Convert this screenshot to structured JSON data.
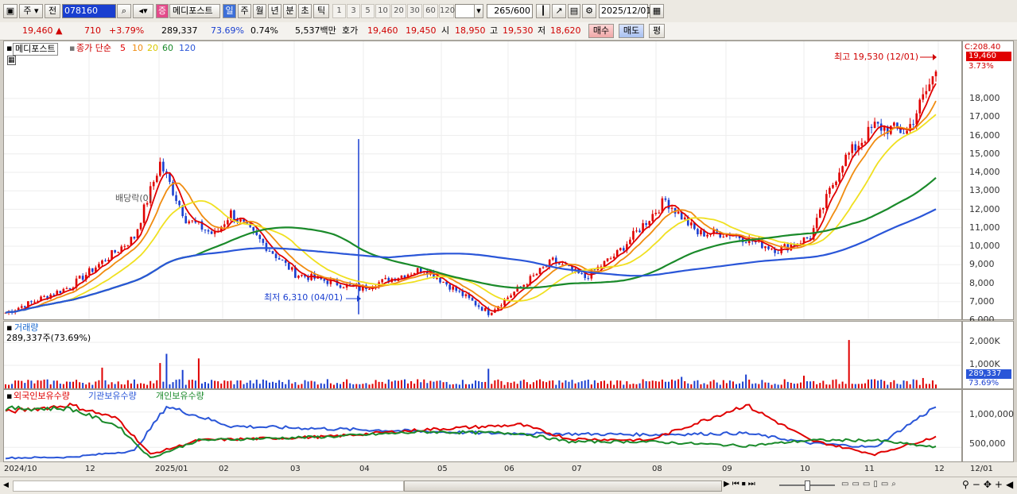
{
  "toolbar": {
    "market": "주",
    "prev": "전",
    "code": "078160",
    "stock_name": "메디포스트",
    "badge": "증",
    "periods": [
      "일",
      "주",
      "월",
      "년",
      "분",
      "초",
      "틱"
    ],
    "minutes": [
      "1",
      "3",
      "5",
      "10",
      "20",
      "30",
      "60",
      "120"
    ],
    "page_count": "265",
    "page_total": "/600",
    "date": "2025/12/01"
  },
  "info": {
    "price": "19,460",
    "change": "710",
    "change_pct": "+3.79%",
    "volume": "289,337",
    "vol_ratio": "73.69%",
    "turnover": "0.74%",
    "amount": "5,537백만",
    "quote_label": "호가",
    "ask": "19,460",
    "bid": "19,450",
    "open_label": "시",
    "open": "18,950",
    "high_label": "고",
    "high": "19,530",
    "low_label": "저",
    "low": "18,620",
    "buy": "매수",
    "sell": "매도",
    "eval": "평"
  },
  "price_pane": {
    "title": "메디포스트",
    "legend_label": "종가 단순",
    "ma_periods": [
      "5",
      "10",
      "20",
      "60",
      "120"
    ],
    "ma_colors": [
      "#e00000",
      "#f08c10",
      "#f0e020",
      "#1a8a2a",
      "#2a56d8"
    ],
    "high_annotation": "최고 19,530 (12/01)",
    "low_annotation": "최저 6,310 (04/01)",
    "mark_text": "배당락(0)",
    "price_tag": "19,460",
    "pct_tag": "3.73%",
    "axis_top": "C:208.40",
    "y_labels": [
      "18,000",
      "17,000",
      "16,000",
      "15,000",
      "14,000",
      "13,000",
      "12,000",
      "11,000",
      "10,000",
      "9,000",
      "8,000",
      "7,000",
      "6,000"
    ]
  },
  "volume_pane": {
    "title": "거래량",
    "value": "289,337주(73.69%)",
    "y_labels": [
      "2,000K",
      "1,000K"
    ],
    "tag": "289,337",
    "tag_pct": "73.69%"
  },
  "holdings_pane": {
    "legends": [
      "외국인보유수량",
      "기관보유수량",
      "개인보유수량"
    ],
    "y_labels": [
      "1,000,000",
      "500,000"
    ]
  },
  "x_labels": [
    "2024/10",
    "12",
    "2025/01",
    "02",
    "03",
    "04",
    "05",
    "06",
    "07",
    "08",
    "09",
    "10",
    "11",
    "12",
    "12/01"
  ],
  "chart_data": [
    {
      "type": "candlestick",
      "title": "메디포스트",
      "x": [
        "2024/10",
        "11",
        "12",
        "2025/01",
        "02",
        "03",
        "04",
        "05",
        "06",
        "07",
        "08",
        "09",
        "10",
        "11",
        "12"
      ],
      "close": [
        6400,
        7800,
        14000,
        11500,
        10600,
        8500,
        7600,
        8800,
        9600,
        12500,
        10700,
        10500,
        14600,
        16500,
        19460
      ],
      "high_point": {
        "value": 19530,
        "date": "12/01"
      },
      "low_point": {
        "value": 6310,
        "date": "04/01"
      },
      "ylim": [
        5500,
        19500
      ]
    },
    {
      "type": "bar",
      "title": "거래량",
      "ylim": [
        0,
        2500
      ],
      "note": "K shares"
    },
    {
      "type": "line",
      "series": [
        {
          "name": "외국인보유수량",
          "color": "#e00000"
        },
        {
          "name": "기관보유수량",
          "color": "#2a56d8"
        },
        {
          "name": "개인보유수량",
          "color": "#1a8a2a"
        }
      ],
      "ylim": [
        300000,
        1200000
      ]
    }
  ]
}
